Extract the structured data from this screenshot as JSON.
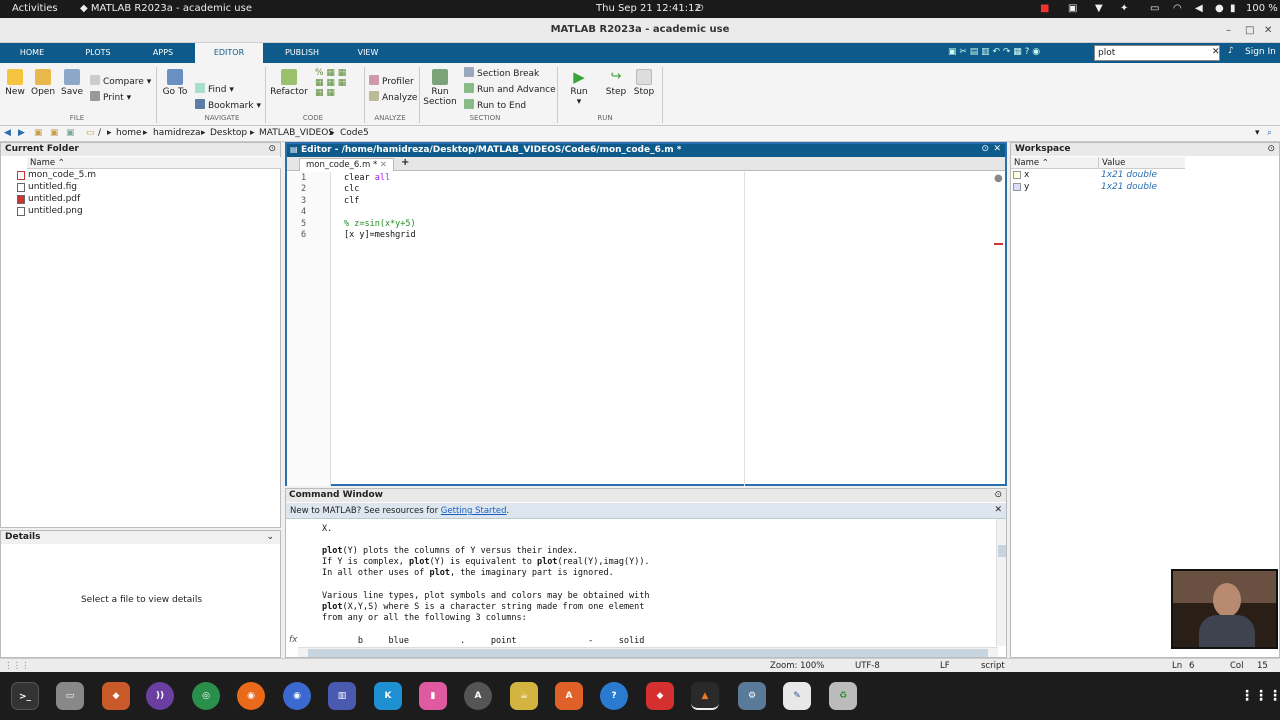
{
  "topbar": {
    "activities": "Activities",
    "app_title": "MATLAB R2023a - academic use",
    "clock": "Thu Sep 21  12:41:12",
    "battery": "100 %"
  },
  "window": {
    "title": "MATLAB R2023a - academic use"
  },
  "tabs": [
    "HOME",
    "PLOTS",
    "APPS",
    "EDITOR",
    "PUBLISH",
    "VIEW"
  ],
  "search": {
    "value": "plot",
    "signin": "Sign In"
  },
  "ribbon": {
    "file": {
      "new": "New",
      "open": "Open",
      "save": "Save",
      "compare": "Compare",
      "print": "Print",
      "group": "FILE"
    },
    "navigate": {
      "goto": "Go To",
      "find": "Find",
      "bookmark": "Bookmark",
      "group": "NAVIGATE"
    },
    "code": {
      "refactor": "Refactor",
      "group": "CODE"
    },
    "analyze": {
      "profiler": "Profiler",
      "analyze": "Analyze",
      "group": "ANALYZE"
    },
    "section": {
      "run_section_1": "Run",
      "run_section_2": "Section",
      "section_break": "Section Break",
      "run_advance": "Run and Advance",
      "run_to_end": "Run to End",
      "group": "SECTION"
    },
    "run": {
      "run": "Run",
      "step": "Step",
      "stop": "Stop",
      "group": "RUN"
    }
  },
  "address": {
    "root": "/",
    "parts": [
      "home",
      "hamidreza",
      "Desktop",
      "MATLAB_VIDEOS",
      "Code5"
    ]
  },
  "current_folder": {
    "title": "Current Folder",
    "col_name": "Name",
    "files": [
      "mon_code_5.m",
      "untitled.fig",
      "untitled.pdf",
      "untitled.png"
    ]
  },
  "details": {
    "title": "Details",
    "message": "Select a file to view details"
  },
  "editor": {
    "title": "Editor - /home/hamidreza/Desktop/MATLAB_VIDEOS/Code6/mon_code_6.m *",
    "tab": "mon_code_6.m *",
    "add_tab": "+",
    "lines": [
      {
        "n": "1",
        "text": "clear ",
        "kw": "all"
      },
      {
        "n": "2",
        "text": "clc"
      },
      {
        "n": "3",
        "text": "clf"
      },
      {
        "n": "4",
        "text": ""
      },
      {
        "n": "5",
        "comment": "% z=sin(x*y+5)"
      },
      {
        "n": "6",
        "text": "[x y]=meshgrid"
      }
    ]
  },
  "workspace": {
    "title": "Workspace",
    "col_name": "Name",
    "col_value": "Value",
    "vars": [
      {
        "name": "x",
        "value": "1x21 double"
      },
      {
        "name": "y",
        "value": "1x21 double"
      }
    ]
  },
  "command_window": {
    "title": "Command Window",
    "banner_text": "New to MATLAB? See resources for ",
    "banner_link": "Getting Started",
    "lines": [
      "X.",
      "",
      "plot(Y) plots the columns of Y versus their index.",
      "If Y is complex, plot(Y) is equivalent to plot(real(Y),imag(Y)).",
      "In all other uses of plot, the imaginary part is ignored.",
      "",
      "Various line types, plot symbols and colors may be obtained with",
      "plot(X,Y,S) where S is a character string made from one element",
      "from any or all the following 3 columns:",
      "",
      "       b     blue          .     point              -     solid"
    ],
    "prompt": "fx"
  },
  "status": {
    "zoom": "Zoom: 100%",
    "encoding": "UTF-8",
    "eol": "LF",
    "type": "script",
    "ln_label": "Ln",
    "ln": "6",
    "col_label": "Col",
    "col": "15"
  },
  "dock": [
    "Terminal",
    "Files",
    "Brave",
    "Podcasts",
    "Chrome Dev",
    "Firefox",
    "Browser",
    "Reader",
    "Kdenlive",
    "Pink",
    "Software",
    "Tea",
    "Store",
    "Help",
    "AnyDesk",
    "MATLAB",
    "Settings",
    "Editor",
    "Trash"
  ],
  "colors": {
    "accent": "#0e5a8a",
    "dock": "#1c1c1c"
  }
}
